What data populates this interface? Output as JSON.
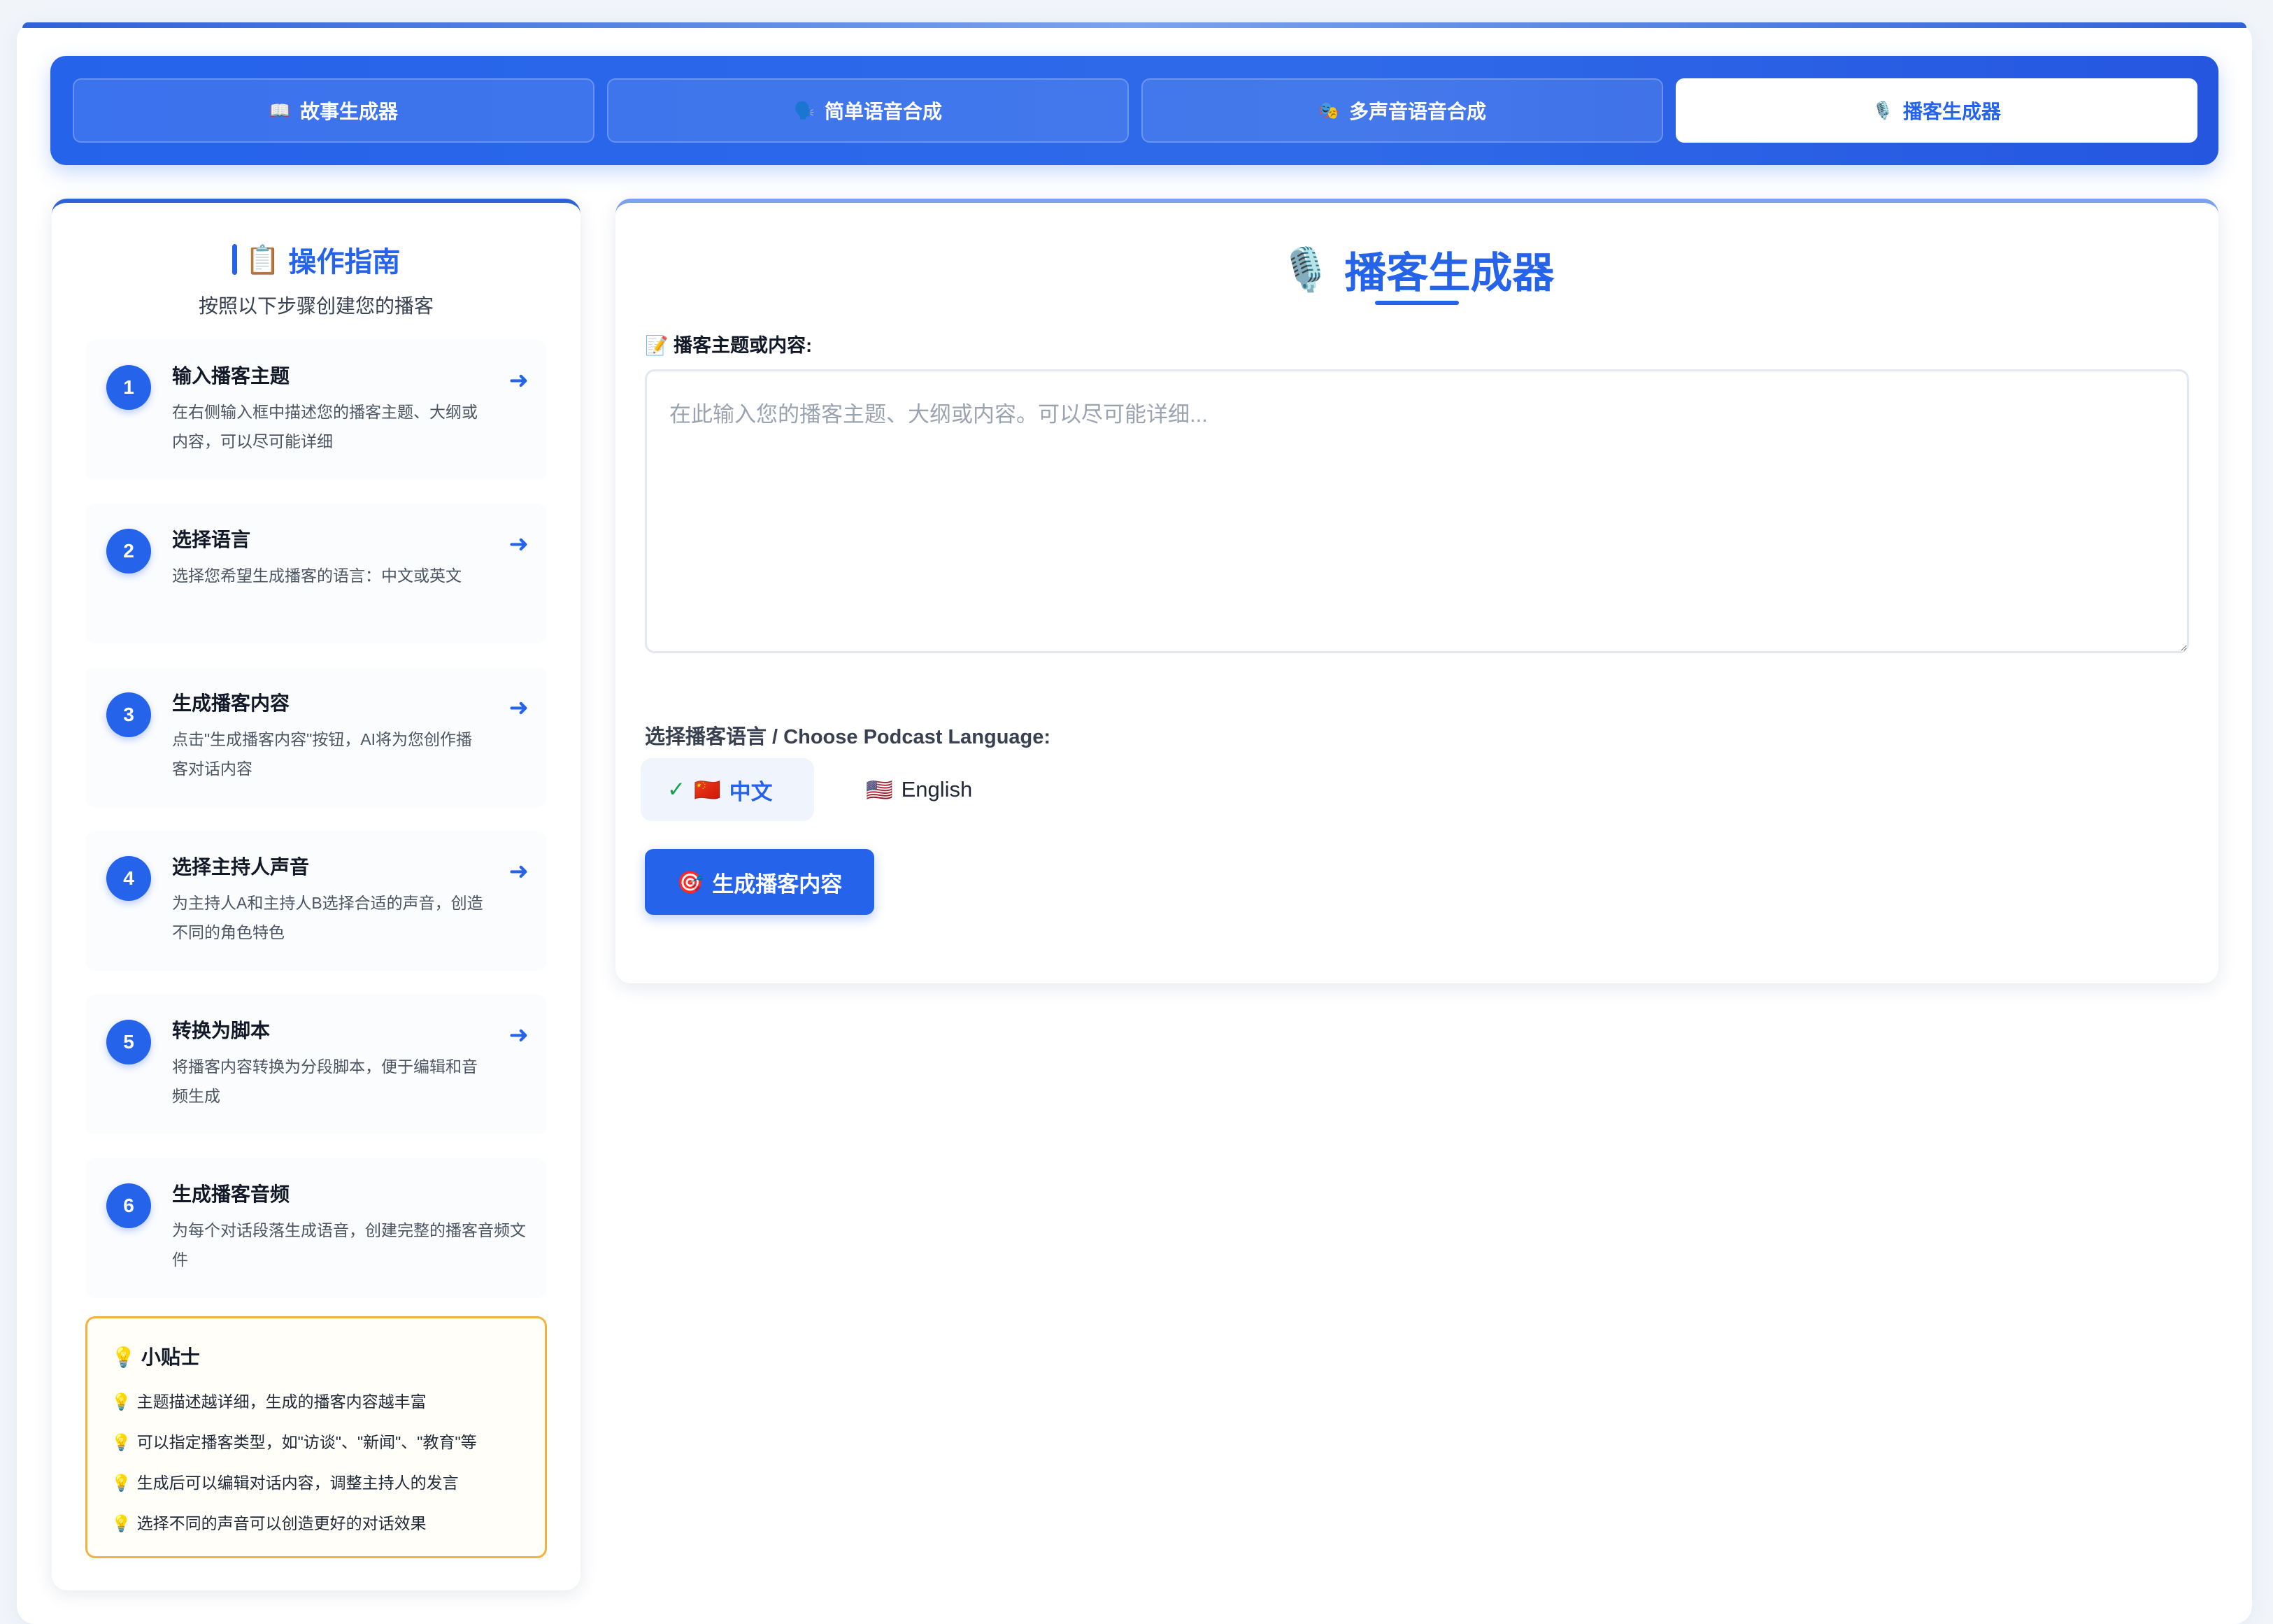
{
  "tabs": [
    {
      "icon": "📖",
      "label": "故事生成器",
      "active": false
    },
    {
      "icon": "🗣️",
      "label": "简单语音合成",
      "active": false
    },
    {
      "icon": "🎭",
      "label": "多声音语音合成",
      "active": false
    },
    {
      "icon": "🎙️",
      "label": "播客生成器",
      "active": true
    }
  ],
  "guide": {
    "title_icon": "📋",
    "title": "操作指南",
    "subtitle": "按照以下步骤创建您的播客",
    "arrow": "➜",
    "steps": [
      {
        "num": "1",
        "title": "输入播客主题",
        "desc": "在右侧输入框中描述您的播客主题、大纲或内容，可以尽可能详细"
      },
      {
        "num": "2",
        "title": "选择语言",
        "desc": "选择您希望生成播客的语言：中文或英文"
      },
      {
        "num": "3",
        "title": "生成播客内容",
        "desc": "点击\"生成播客内容\"按钮，AI将为您创作播客对话内容"
      },
      {
        "num": "4",
        "title": "选择主持人声音",
        "desc": "为主持人A和主持人B选择合适的声音，创造不同的角色特色"
      },
      {
        "num": "5",
        "title": "转换为脚本",
        "desc": "将播客内容转换为分段脚本，便于编辑和音频生成"
      },
      {
        "num": "6",
        "title": "生成播客音频",
        "desc": "为每个对话段落生成语音，创建完整的播客音频文件"
      }
    ]
  },
  "tips": {
    "icon": "💡",
    "title": "小贴士",
    "items": [
      "主题描述越详细，生成的播客内容越丰富",
      "可以指定播客类型，如\"访谈\"、\"新闻\"、\"教育\"等",
      "生成后可以编辑对话内容，调整主持人的发言",
      "选择不同的声音可以创造更好的对话效果"
    ]
  },
  "main": {
    "title_icon": "🎙️",
    "title": "播客生成器",
    "topic_label": "📝 播客主题或内容:",
    "topic_placeholder": "在此输入您的播客主题、大纲或内容。可以尽可能详细...",
    "topic_value": "",
    "language_label": "选择播客语言 / Choose Podcast Language:",
    "languages": [
      {
        "flag": "🇨🇳",
        "label": "中文",
        "selected": true
      },
      {
        "flag": "🇺🇸",
        "label": "English",
        "selected": false
      }
    ],
    "selected_check": "✓",
    "generate_icon": "🎯",
    "generate_label": "生成播客内容"
  },
  "colors": {
    "accent": "#2563eb",
    "tip_border": "#f2b33d",
    "check": "#16a34a"
  }
}
